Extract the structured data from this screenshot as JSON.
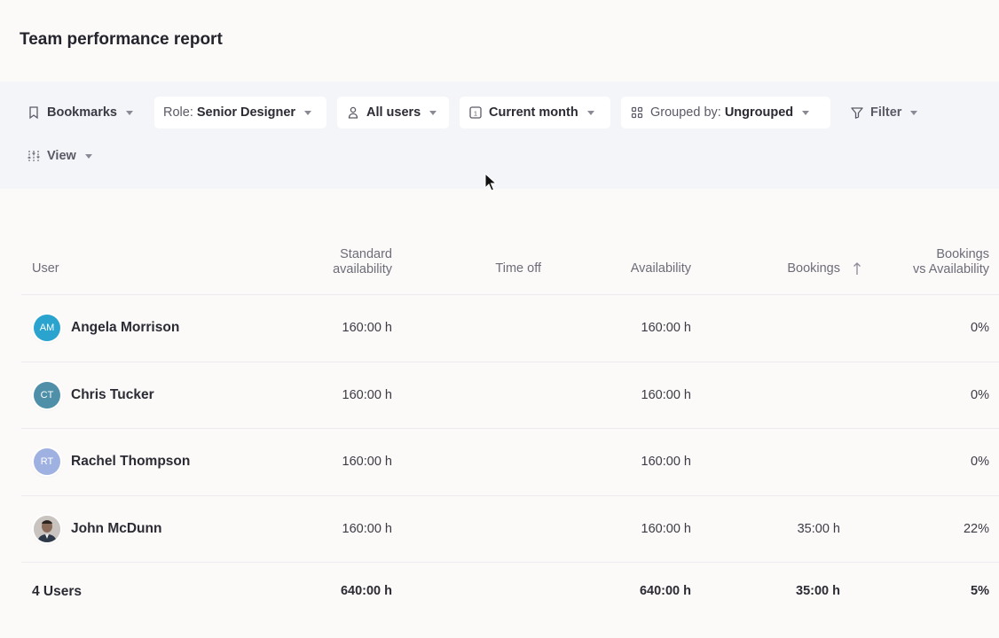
{
  "page": {
    "title": "Team performance report"
  },
  "toolbar": {
    "bookmarks": {
      "label": "Bookmarks"
    },
    "role": {
      "prefix": "Role:",
      "value": "Senior Designer"
    },
    "users": {
      "label": "All users"
    },
    "period": {
      "label": "Current month"
    },
    "grouping": {
      "prefix": "Grouped by:",
      "value": "Ungrouped"
    },
    "filter": {
      "label": "Filter"
    },
    "view": {
      "label": "View"
    }
  },
  "table": {
    "columns": {
      "user": "User",
      "standard_line1": "Standard",
      "standard_line2": "availability",
      "time_off": "Time off",
      "availability": "Availability",
      "bookings": "Bookings",
      "bva_line1": "Bookings",
      "bva_line2": "vs Availability"
    },
    "sort": {
      "column": "Bookings",
      "direction": "ascending"
    },
    "rows": [
      {
        "initials": "AM",
        "name": "Angela Morrison",
        "standard": "160:00 h",
        "time_off": "",
        "availability": "160:00 h",
        "bookings": "",
        "bva": "0%",
        "avatar_color": "#2ba3cf"
      },
      {
        "initials": "CT",
        "name": "Chris Tucker",
        "standard": "160:00 h",
        "time_off": "",
        "availability": "160:00 h",
        "bookings": "",
        "bva": "0%",
        "avatar_color": "#4f8fa8"
      },
      {
        "initials": "RT",
        "name": "Rachel Thompson",
        "standard": "160:00 h",
        "time_off": "",
        "availability": "160:00 h",
        "bookings": "",
        "bva": "0%",
        "avatar_color": "#9fb1e0"
      },
      {
        "initials": "",
        "name": "John McDunn",
        "standard": "160:00 h",
        "time_off": "",
        "availability": "160:00 h",
        "bookings": "35:00 h",
        "bva": "22%",
        "avatar_color": "#6b6b70"
      }
    ],
    "total": {
      "label": "4 Users",
      "standard": "640:00 h",
      "availability": "640:00 h",
      "bookings": "35:00 h",
      "bva": "5%"
    }
  },
  "colors": {
    "background": "#fcf9f9",
    "toolbar_bg": "#f4f5f9",
    "text": "#2b2b33",
    "muted": "#6d6d78"
  }
}
